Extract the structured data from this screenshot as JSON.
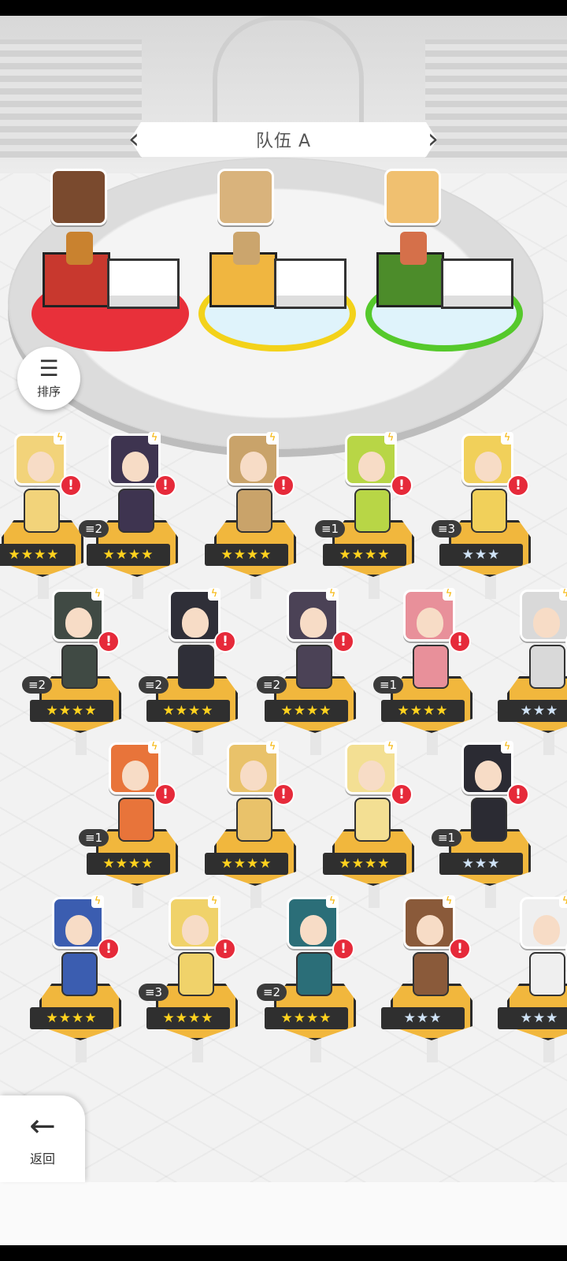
{
  "team": {
    "title": "队伍 A",
    "prev_icon": "chevron-left-icon",
    "next_icon": "chevron-right-icon"
  },
  "sort_button": {
    "label": "排序",
    "icon": "sort-list-icon"
  },
  "back_button": {
    "label": "返回",
    "icon": "arrow-left-icon"
  },
  "leaders": [
    {
      "ring_color": "#e8303a",
      "cube_color": "#c8382e",
      "portrait_color": "#7a4a2e",
      "badge": "star",
      "sprite_color": "#c9822f"
    },
    {
      "ring_color": "#f3d21a",
      "cube_color": "#f0b640",
      "portrait_color": "#d9b37c",
      "badge": "lightning",
      "sprite_color": "#cba56d"
    },
    {
      "ring_color": "#55c92b",
      "cube_color": "#4c8c2a",
      "portrait_color": "#f0c070",
      "badge": "leaf",
      "sprite_color": "#d5704a"
    }
  ],
  "heroes": [
    {
      "stars": "★★★★",
      "level": "",
      "silver": false,
      "hair": "#f2d37a"
    },
    {
      "stars": "★★★★",
      "level": "2",
      "silver": false,
      "hair": "#3e3450"
    },
    {
      "stars": "★★★★",
      "level": "",
      "silver": false,
      "hair": "#c9a36a"
    },
    {
      "stars": "★★★★",
      "level": "1",
      "silver": false,
      "hair": "#b8d646"
    },
    {
      "stars": "★★★",
      "level": "3",
      "silver": true,
      "hair": "#f1d05a"
    },
    {
      "stars": "★★★★",
      "level": "2",
      "silver": false,
      "hair": "#404a44"
    },
    {
      "stars": "★★★★",
      "level": "2",
      "silver": false,
      "hair": "#2f2f38"
    },
    {
      "stars": "★★★★",
      "level": "2",
      "silver": false,
      "hair": "#4b4256"
    },
    {
      "stars": "★★★★",
      "level": "1",
      "silver": false,
      "hair": "#e8909a"
    },
    {
      "stars": "★★★",
      "level": "",
      "silver": true,
      "hair": "#d9d9d9"
    },
    {
      "stars": "★★★★",
      "level": "1",
      "silver": false,
      "hair": "#e8743a"
    },
    {
      "stars": "★★★★",
      "level": "",
      "silver": false,
      "hair": "#e9c26a"
    },
    {
      "stars": "★★★★",
      "level": "",
      "silver": false,
      "hair": "#f3df93"
    },
    {
      "stars": "★★★",
      "level": "1",
      "silver": true,
      "hair": "#2b2b33"
    },
    {
      "stars": "★★★★",
      "level": "",
      "silver": false,
      "hair": "#3b5db0"
    },
    {
      "stars": "★★★★",
      "level": "3",
      "silver": false,
      "hair": "#f0d26a"
    },
    {
      "stars": "★★★★",
      "level": "2",
      "silver": false,
      "hair": "#2b6e78"
    },
    {
      "stars": "★★★",
      "level": "",
      "silver": true,
      "hair": "#8a5a3a"
    },
    {
      "stars": "★★★",
      "level": "",
      "silver": true,
      "hair": "#efefef"
    }
  ]
}
